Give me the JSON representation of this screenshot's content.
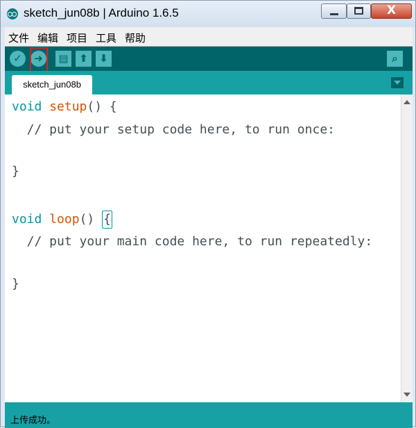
{
  "window": {
    "title": "sketch_jun08b | Arduino 1.6.5",
    "app_icon": "arduino-logo-icon",
    "controls": {
      "minimize_icon": "minimize-icon",
      "maximize_icon": "maximize-icon",
      "close_label": "X"
    }
  },
  "menubar": {
    "items": [
      "文件",
      "编辑",
      "项目",
      "工具",
      "帮助"
    ]
  },
  "toolbar": {
    "buttons": [
      {
        "name": "verify",
        "icon": "check-icon",
        "glyph": "✓"
      },
      {
        "name": "upload",
        "icon": "arrow-right-icon",
        "glyph": "➜",
        "highlighted": true
      },
      {
        "name": "new",
        "icon": "new-file-icon",
        "glyph": "▤"
      },
      {
        "name": "open",
        "icon": "arrow-up-icon",
        "glyph": "⬆"
      },
      {
        "name": "save",
        "icon": "arrow-down-icon",
        "glyph": "⬇"
      }
    ],
    "serial_monitor_icon": "magnifier-icon",
    "serial_monitor_glyph": "⌕",
    "highlight_color": "#e02020"
  },
  "tabs": [
    {
      "label": "sketch_jun08b",
      "active": true
    }
  ],
  "editor": {
    "line1": {
      "type": "void",
      "fn": "setup",
      "rest": "() {"
    },
    "line2": {
      "comment": "  // put your setup code here, to run once:"
    },
    "line3": {
      "text": "}"
    },
    "line4": {
      "type": "void",
      "fn": "loop",
      "rest": "() ",
      "brace": "{"
    },
    "line5": {
      "comment": "  // put your main code here, to run repeatedly:"
    },
    "line6": {
      "text": "}"
    }
  },
  "status": {
    "message": "上传成功。"
  },
  "colors": {
    "toolbar": "#006468",
    "tabbar": "#17a1a5",
    "button": "#4db7bb",
    "keyword_type": "#00979c",
    "keyword_fn": "#d35400",
    "code_text": "#434f54"
  }
}
